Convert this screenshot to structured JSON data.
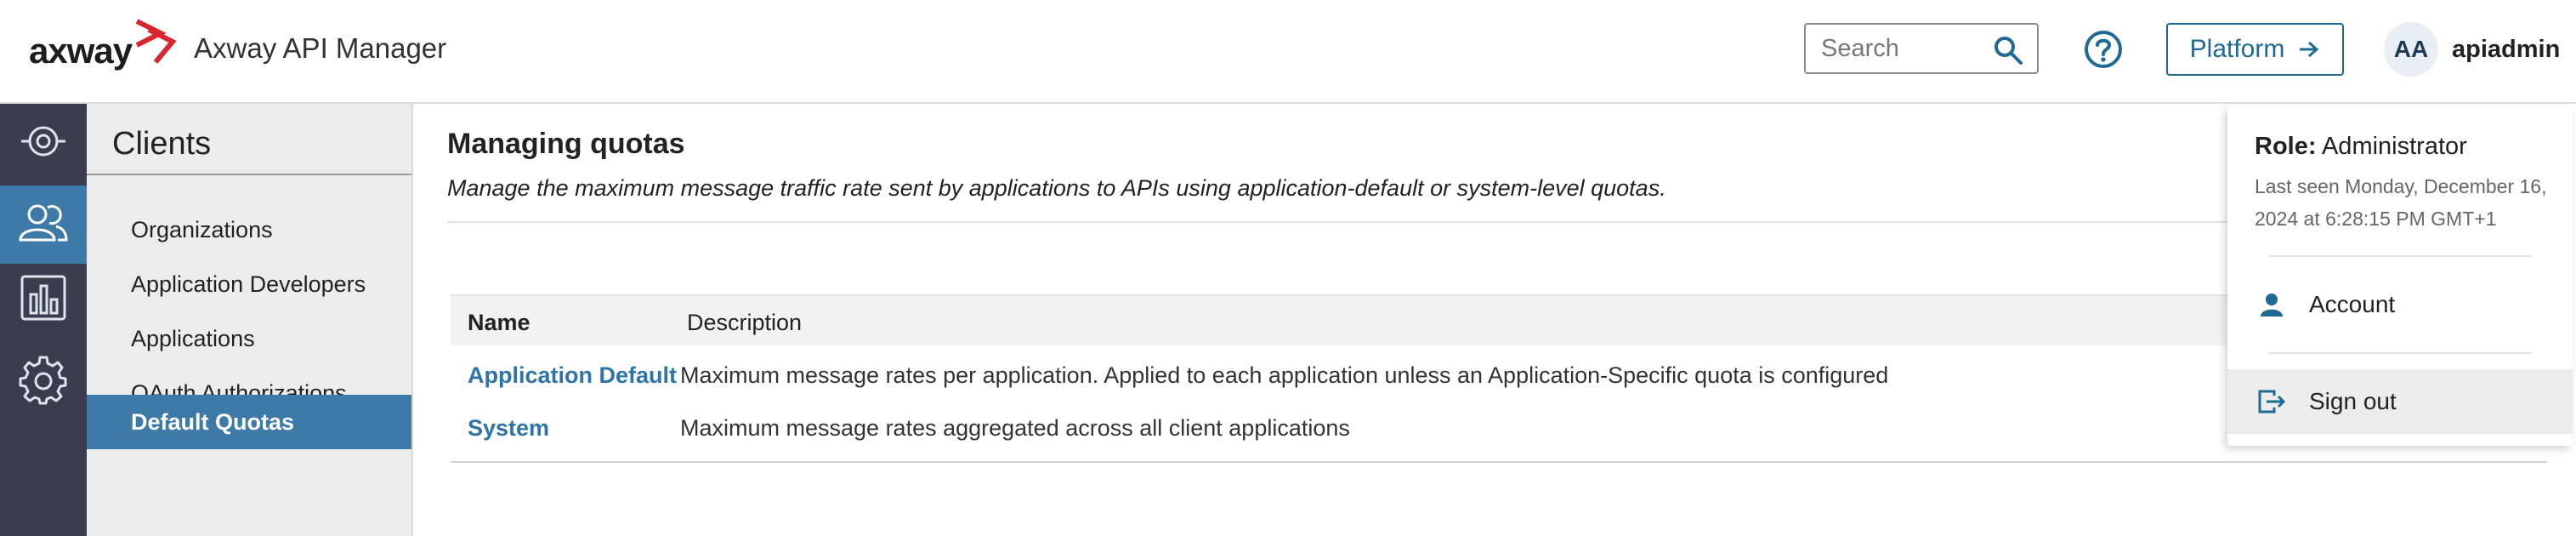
{
  "header": {
    "logo_text": "axway",
    "app_title": "Axway API Manager",
    "search_placeholder": "Search",
    "platform_label": "Platform",
    "user_initials": "AA",
    "username": "apiadmin"
  },
  "leftnav": {
    "items": [
      {
        "icon": "dashboard-target-icon",
        "active": false
      },
      {
        "icon": "users-icon",
        "active": true
      },
      {
        "icon": "analytics-bars-icon",
        "active": false
      },
      {
        "icon": "gear-icon",
        "active": false
      }
    ]
  },
  "subnav": {
    "title": "Clients",
    "items": [
      {
        "label": "Organizations"
      },
      {
        "label": "Application Developers"
      },
      {
        "label": "Applications"
      },
      {
        "label": "OAuth Authorizations"
      },
      {
        "label": "Default Quotas",
        "active": true
      }
    ]
  },
  "main": {
    "title": "Managing quotas",
    "subtitle": "Manage the maximum message traffic rate sent by applications to APIs using application-default or system-level quotas.",
    "table": {
      "headers": [
        "Name",
        "Description"
      ],
      "rows": [
        {
          "name": "Application Default",
          "description": "Maximum message rates per application. Applied to each application unless an Application-Specific quota is configured"
        },
        {
          "name": "System",
          "description": "Maximum message rates aggregated across all client applications"
        }
      ]
    }
  },
  "user_menu": {
    "role_label": "Role:",
    "role_value": "Administrator",
    "last_seen": "Last seen Monday, December 16, 2024 at 6:28:15 PM GMT+1",
    "items": [
      {
        "label": "Account",
        "icon": "person-icon"
      },
      {
        "label": "Sign out",
        "icon": "sign-out-icon"
      }
    ]
  },
  "colors": {
    "accent": "#3d7aa8",
    "link": "#2e74a6",
    "sidebar": "#3b3c50",
    "logo_red": "#d9262e"
  }
}
